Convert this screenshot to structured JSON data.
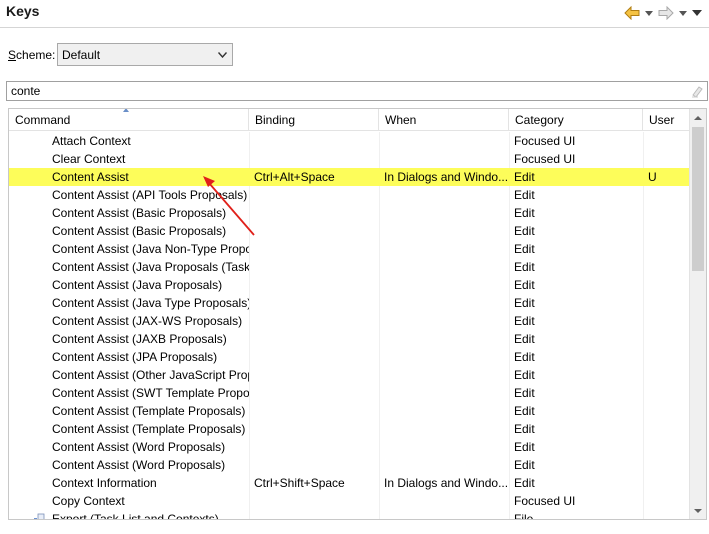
{
  "header": {
    "title": "Keys",
    "back_icon": "back-arrow-icon",
    "forward_icon": "forward-arrow-icon"
  },
  "scheme": {
    "label_accesskey": "S",
    "label_rest": "cheme:",
    "value": "Default"
  },
  "filter": {
    "value": "conte"
  },
  "colors": {
    "selected_row": "#fdfd5a",
    "arrow": "#e0201a"
  },
  "table": {
    "columns": [
      "Command",
      "Binding",
      "When",
      "Category",
      "User"
    ],
    "rows": [
      {
        "command": "Attach Context",
        "binding": "",
        "when": "",
        "category": "Focused UI",
        "user": ""
      },
      {
        "command": "Clear Context",
        "binding": "",
        "when": "",
        "category": "Focused UI",
        "user": ""
      },
      {
        "command": "Content Assist",
        "binding": "Ctrl+Alt+Space",
        "when": "In Dialogs and Windo...",
        "category": "Edit",
        "user": "U"
      },
      {
        "command": "Content Assist (API Tools Proposals)",
        "binding": "",
        "when": "",
        "category": "Edit",
        "user": ""
      },
      {
        "command": "Content Assist (Basic Proposals)",
        "binding": "",
        "when": "",
        "category": "Edit",
        "user": ""
      },
      {
        "command": "Content Assist (Basic Proposals)",
        "binding": "",
        "when": "",
        "category": "Edit",
        "user": ""
      },
      {
        "command": "Content Assist (Java Non-Type Proposals)",
        "binding": "",
        "when": "",
        "category": "Edit",
        "user": ""
      },
      {
        "command": "Content Assist (Java Proposals (Task-Focused))",
        "binding": "",
        "when": "",
        "category": "Edit",
        "user": ""
      },
      {
        "command": "Content Assist (Java Proposals)",
        "binding": "",
        "when": "",
        "category": "Edit",
        "user": ""
      },
      {
        "command": "Content Assist (Java Type Proposals)",
        "binding": "",
        "when": "",
        "category": "Edit",
        "user": ""
      },
      {
        "command": "Content Assist (JAX-WS Proposals)",
        "binding": "",
        "when": "",
        "category": "Edit",
        "user": ""
      },
      {
        "command": "Content Assist (JAXB Proposals)",
        "binding": "",
        "when": "",
        "category": "Edit",
        "user": ""
      },
      {
        "command": "Content Assist (JPA Proposals)",
        "binding": "",
        "when": "",
        "category": "Edit",
        "user": ""
      },
      {
        "command": "Content Assist (Other JavaScript Proposals)",
        "binding": "",
        "when": "",
        "category": "Edit",
        "user": ""
      },
      {
        "command": "Content Assist (SWT Template Proposals)",
        "binding": "",
        "when": "",
        "category": "Edit",
        "user": ""
      },
      {
        "command": "Content Assist (Template Proposals)",
        "binding": "",
        "when": "",
        "category": "Edit",
        "user": ""
      },
      {
        "command": "Content Assist (Template Proposals)",
        "binding": "",
        "when": "",
        "category": "Edit",
        "user": ""
      },
      {
        "command": "Content Assist (Word Proposals)",
        "binding": "",
        "when": "",
        "category": "Edit",
        "user": ""
      },
      {
        "command": "Content Assist (Word Proposals)",
        "binding": "",
        "when": "",
        "category": "Edit",
        "user": ""
      },
      {
        "command": "Context Information",
        "binding": "Ctrl+Shift+Space",
        "when": "In Dialogs and Windo...",
        "category": "Edit",
        "user": ""
      },
      {
        "command": "Copy Context",
        "binding": "",
        "when": "",
        "category": "Focused UI",
        "user": ""
      },
      {
        "command": "Export (Task List and Contexts)",
        "binding": "",
        "when": "",
        "category": "File",
        "user": "",
        "icon": "export-icon"
      }
    ]
  }
}
